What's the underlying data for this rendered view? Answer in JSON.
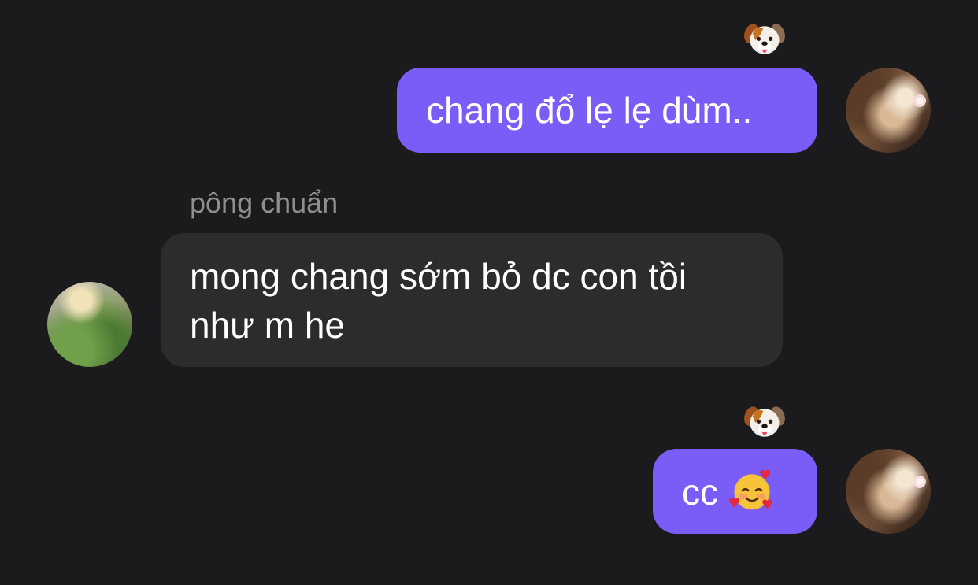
{
  "theme": {
    "background": "#1b1b1e",
    "outgoing_bubble": "#7a5cf6",
    "incoming_bubble": "#2c2c2f",
    "sender_name_color": "#8e8e93"
  },
  "messages": [
    {
      "direction": "outgoing",
      "text": "chang đổ lẹ lẹ dùm..",
      "reaction_icon": "dog-face-emoji",
      "avatar_icon": "user-avatar-self"
    },
    {
      "direction": "incoming",
      "sender": "pông chuẩn",
      "text": "mong chang sớm bỏ dc con tồi như m he",
      "avatar_icon": "user-avatar-pong-chuan"
    },
    {
      "direction": "outgoing",
      "text": "cc",
      "inline_emoji": "smiling-face-with-hearts-emoji",
      "reaction_icon": "dog-face-emoji",
      "avatar_icon": "user-avatar-self"
    }
  ]
}
